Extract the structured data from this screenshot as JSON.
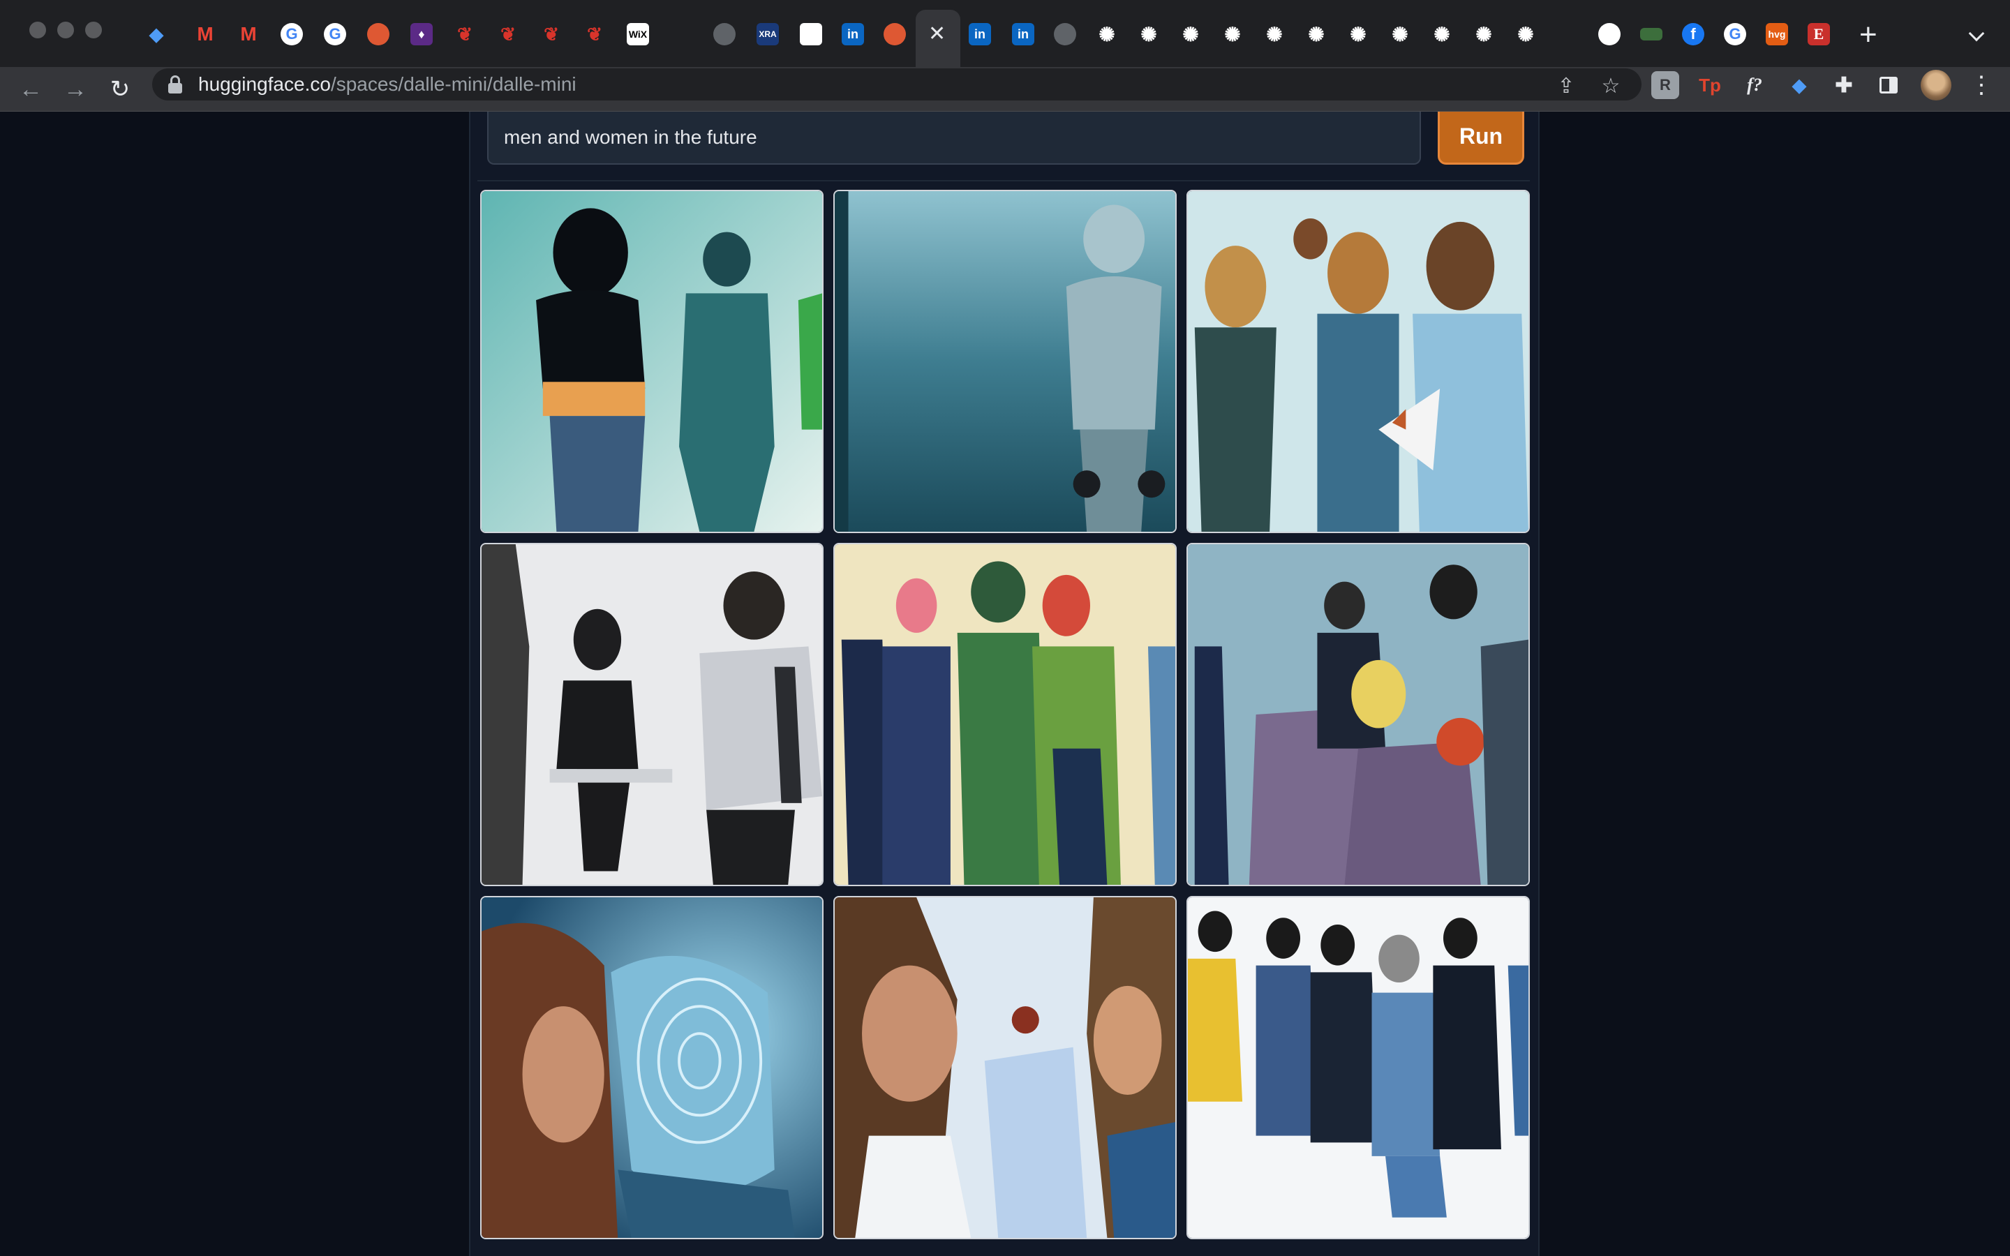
{
  "browser": {
    "address": {
      "host": "huggingface.co",
      "path": "/spaces/dalle-mini/dalle-mini"
    },
    "tab_icons": [
      "gem-icon",
      "gmail-icon",
      "gmail-icon",
      "google-icon",
      "google-icon",
      "duckduckgo-icon",
      "purple-extension-icon",
      "red-bird-icon",
      "red-bird-icon",
      "red-bird-icon",
      "red-bird-icon",
      "wix-icon",
      "globe-icon",
      "xra-icon",
      "white-square-icon",
      "linkedin-icon",
      "duckduckgo-icon",
      "close-icon",
      "linkedin-icon",
      "linkedin-icon",
      "globe-icon",
      "gear-icon",
      "gear-icon",
      "gear-icon",
      "gear-icon",
      "gear-icon",
      "gear-icon",
      "gear-icon",
      "gear-icon",
      "gear-icon",
      "gear-icon",
      "gear-icon",
      "github-icon",
      "green-badge-icon",
      "facebook-icon",
      "google-icon",
      "hvg-icon",
      "e-icon"
    ],
    "tab_labels": {
      "wix": "WiX",
      "xra": "XRA",
      "hvg": "hvg",
      "e": "E"
    },
    "extensions": [
      {
        "name": "reader-extension-icon",
        "label": "R"
      },
      {
        "name": "tp-extension-icon",
        "label": "Tp"
      },
      {
        "name": "fonts-extension-icon",
        "label": "f?"
      },
      {
        "name": "gem-extension-icon",
        "label": "◆"
      }
    ]
  },
  "app": {
    "prompt": "men and women in the future",
    "run_label": "Run",
    "images": [
      "generated-image-1",
      "generated-image-2",
      "generated-image-3",
      "generated-image-4",
      "generated-image-5",
      "generated-image-6",
      "generated-image-7",
      "generated-image-8",
      "generated-image-9"
    ]
  },
  "colors": {
    "accent": "#c2671a",
    "page_bg": "#0b0f19",
    "panel_bg": "#111827"
  }
}
